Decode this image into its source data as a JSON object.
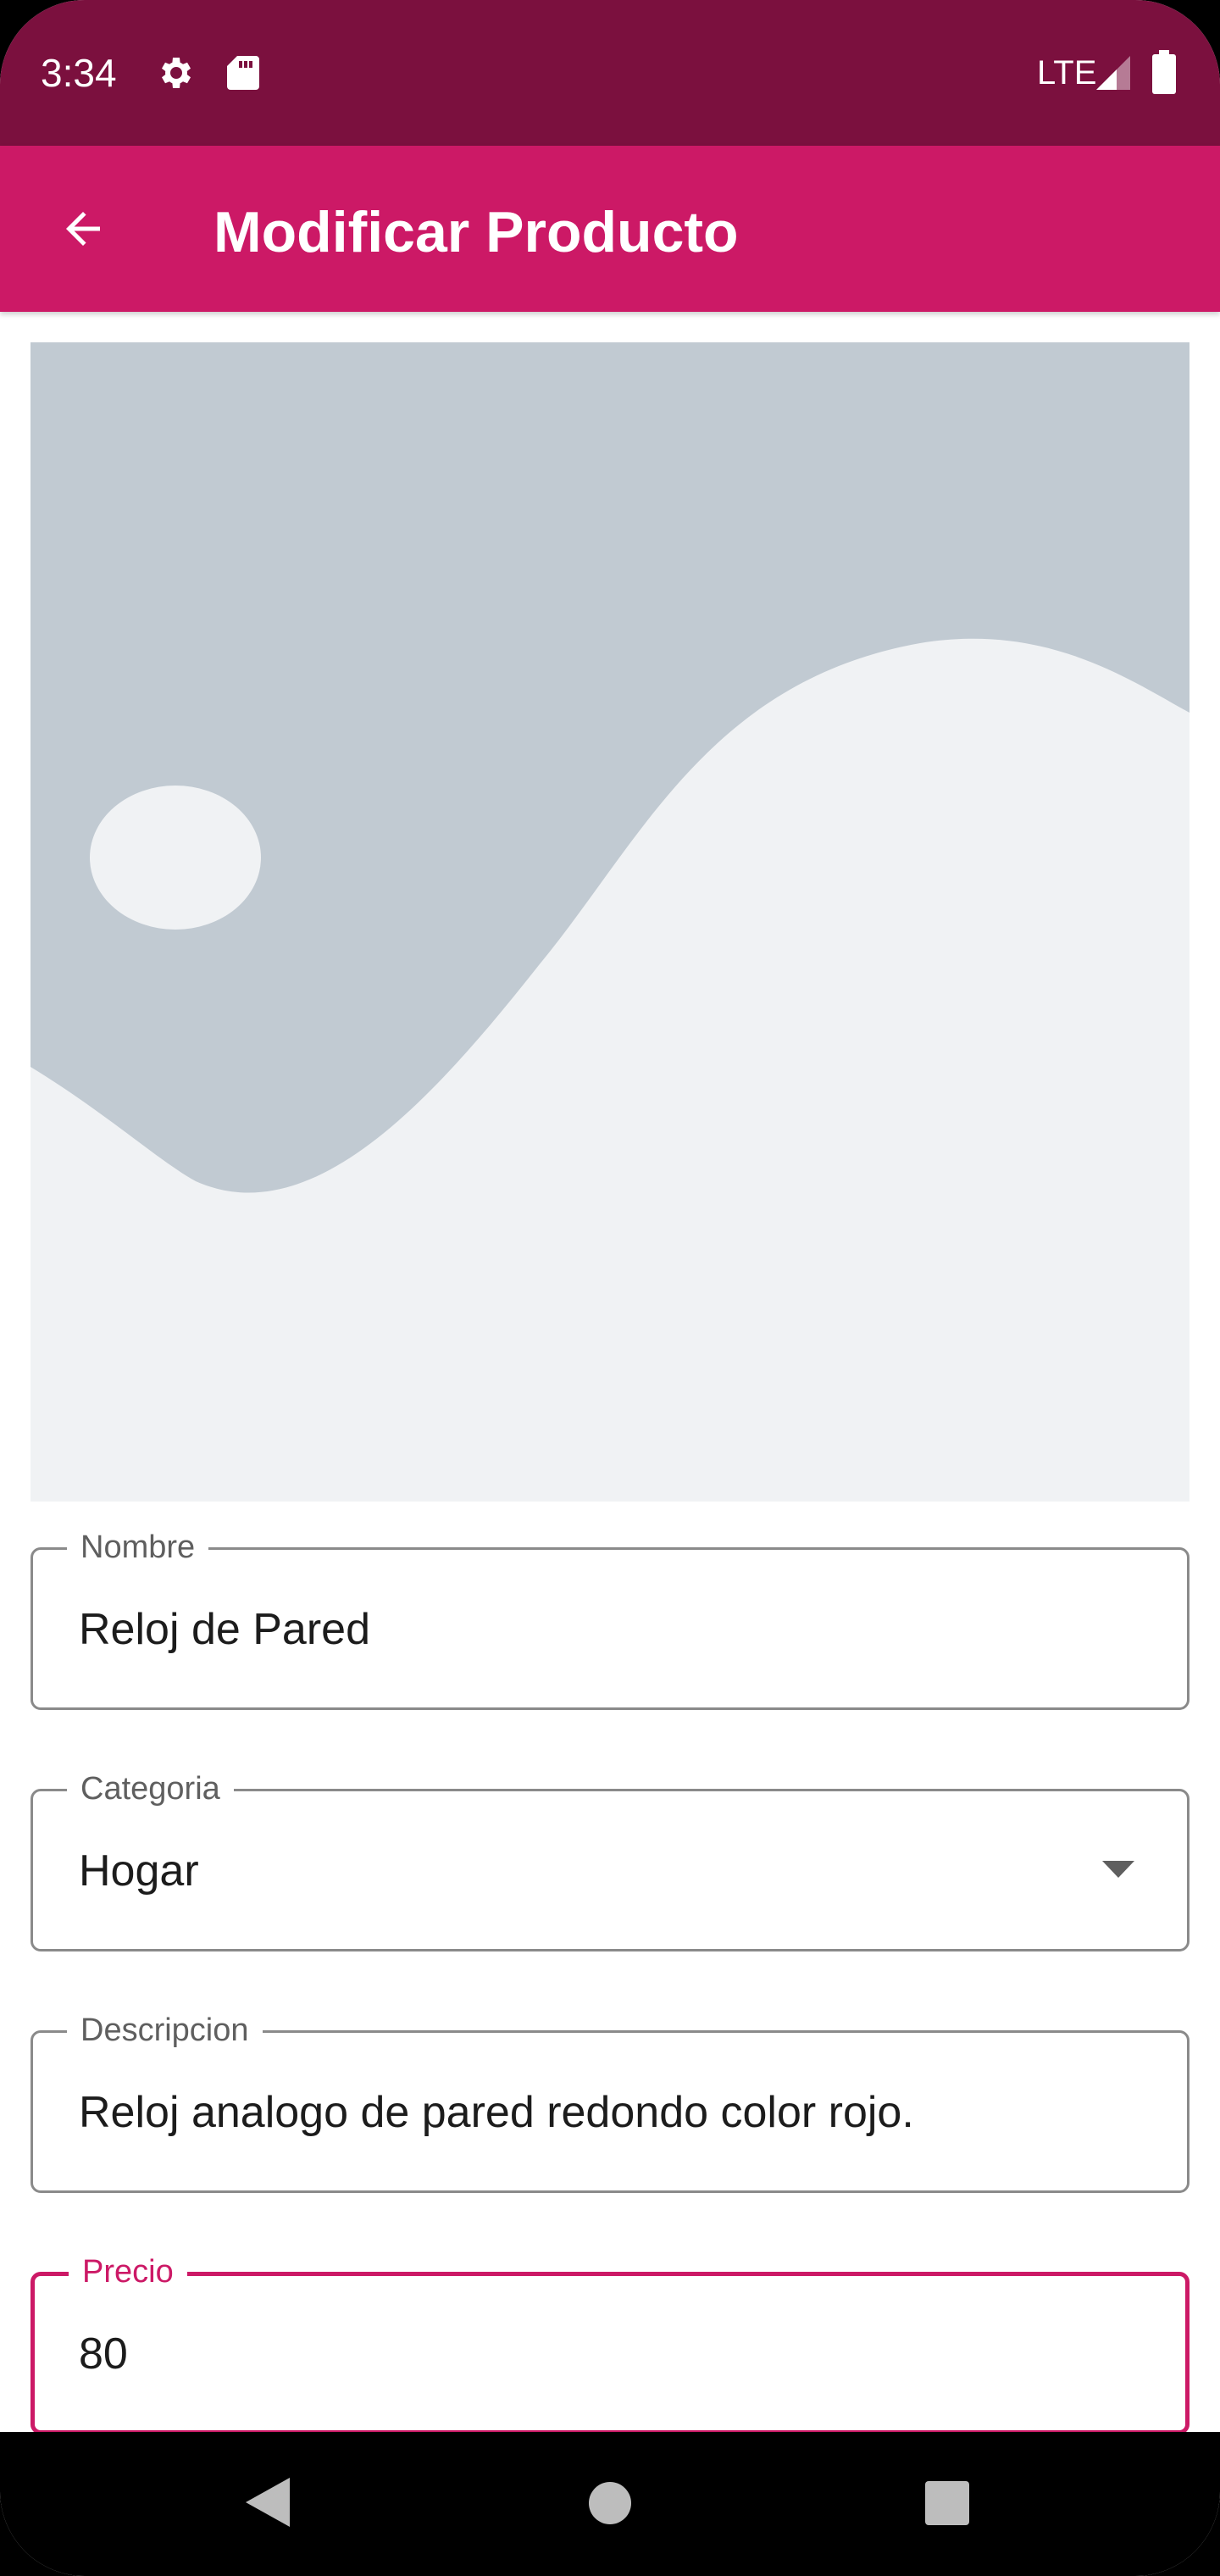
{
  "status_bar": {
    "time": "3:34",
    "network": "LTE",
    "icons": [
      "gear-icon",
      "sd-card-icon",
      "signal-icon",
      "battery-icon"
    ]
  },
  "app_bar": {
    "title": "Modificar Producto",
    "back_icon": "arrow-back-icon"
  },
  "product_image": {
    "icon": "image-placeholder-icon"
  },
  "form": {
    "nombre": {
      "label": "Nombre",
      "value": "Reloj de Pared"
    },
    "categoria": {
      "label": "Categoria",
      "value": "Hogar"
    },
    "descripcion": {
      "label": "Descripcion",
      "value": "Reloj analogo de pared redondo color rojo."
    },
    "precio": {
      "label": "Precio",
      "value": "80"
    }
  },
  "nav_bar": {
    "icons": [
      "nav-back-icon",
      "nav-home-icon",
      "nav-recents-icon"
    ]
  },
  "colors": {
    "status_bar": "#7b103e",
    "app_bar": "#cc1966",
    "accent": "#cc1966",
    "placeholder_bg": "#c1cad2",
    "placeholder_fg": "#f0f2f4"
  }
}
